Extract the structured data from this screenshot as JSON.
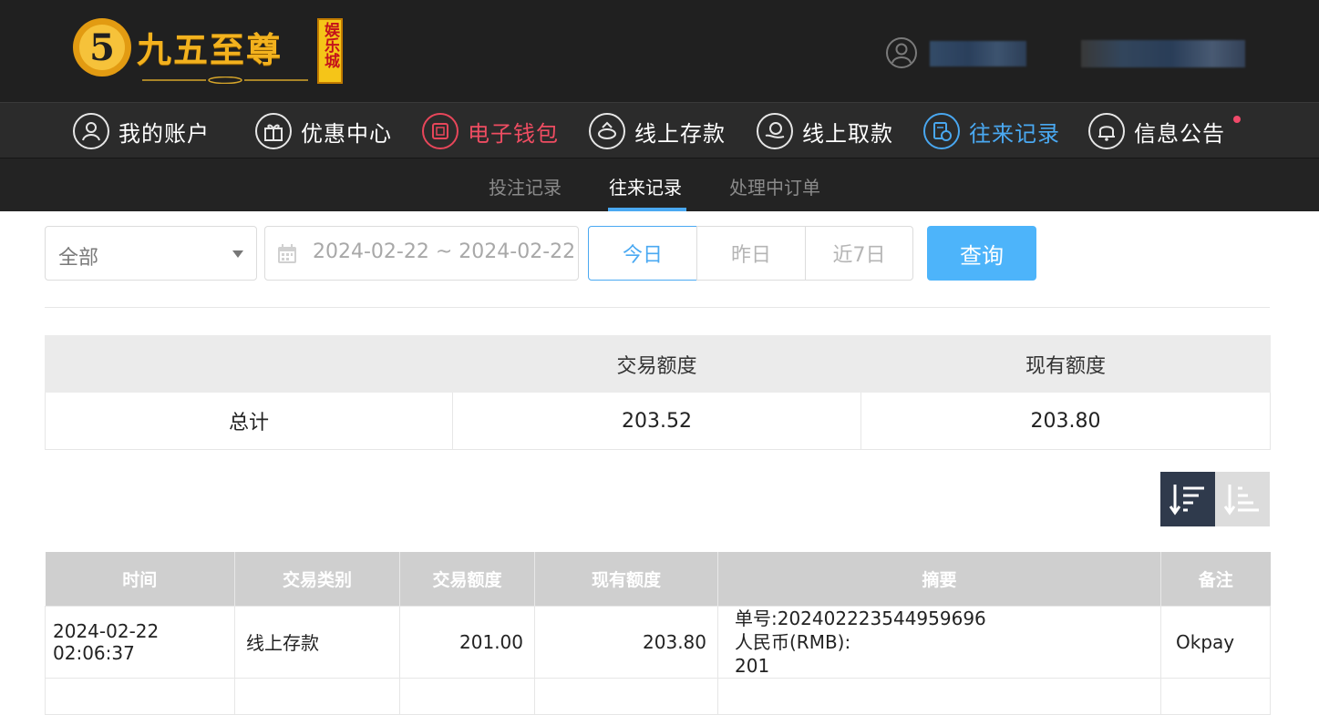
{
  "brand": {
    "name": "九五至尊",
    "badge": "娱乐城",
    "emblem_digit": "5",
    "gold": "#f3b21e",
    "badge_red": "#c4121b"
  },
  "main_nav": [
    {
      "label": "我的账户",
      "icon": "user-icon",
      "state": "normal"
    },
    {
      "label": "优惠中心",
      "icon": "gift-icon",
      "state": "normal"
    },
    {
      "label": "电子钱包",
      "icon": "wallet-icon",
      "state": "highlight"
    },
    {
      "label": "线上存款",
      "icon": "deposit-icon",
      "state": "normal"
    },
    {
      "label": "线上取款",
      "icon": "withdraw-icon",
      "state": "normal"
    },
    {
      "label": "往来记录",
      "icon": "records-icon",
      "state": "active"
    },
    {
      "label": "信息公告",
      "icon": "bell-icon",
      "state": "normal",
      "has_unread_dot": true
    }
  ],
  "sub_nav": [
    {
      "label": "投注记录",
      "active": false
    },
    {
      "label": "往来记录",
      "active": true
    },
    {
      "label": "处理中订单",
      "active": false
    }
  ],
  "filters": {
    "type_select": "全部",
    "date_range": "2024-02-22 ~ 2024-02-22",
    "quick_ranges": [
      {
        "label": "今日",
        "selected": true
      },
      {
        "label": "昨日",
        "selected": false
      },
      {
        "label": "近7日",
        "selected": false
      }
    ],
    "query_label": "查询"
  },
  "summary": {
    "headers": [
      "",
      "交易额度",
      "现有额度"
    ],
    "row": [
      "总计",
      "203.52",
      "203.80"
    ]
  },
  "records": {
    "headers": [
      "时间",
      "交易类别",
      "交易额度",
      "现有额度",
      "摘要",
      "备注"
    ],
    "rows": [
      {
        "time": "2024-02-22 02:06:37",
        "category": "线上存款",
        "amount": "201.00",
        "balance": "203.80",
        "summary_lines": [
          "单号:202402223544959696",
          "人民币(RMB):",
          "201"
        ],
        "remark": "Okpay"
      }
    ]
  },
  "colors": {
    "accent_blue": "#4aa9f2",
    "query_blue": "#4db4fa",
    "nav_red": "#ef4d62",
    "unread_dot": "#f04a6a",
    "header_bg": "#202020",
    "sort_active_bg": "#2f3a4c"
  }
}
